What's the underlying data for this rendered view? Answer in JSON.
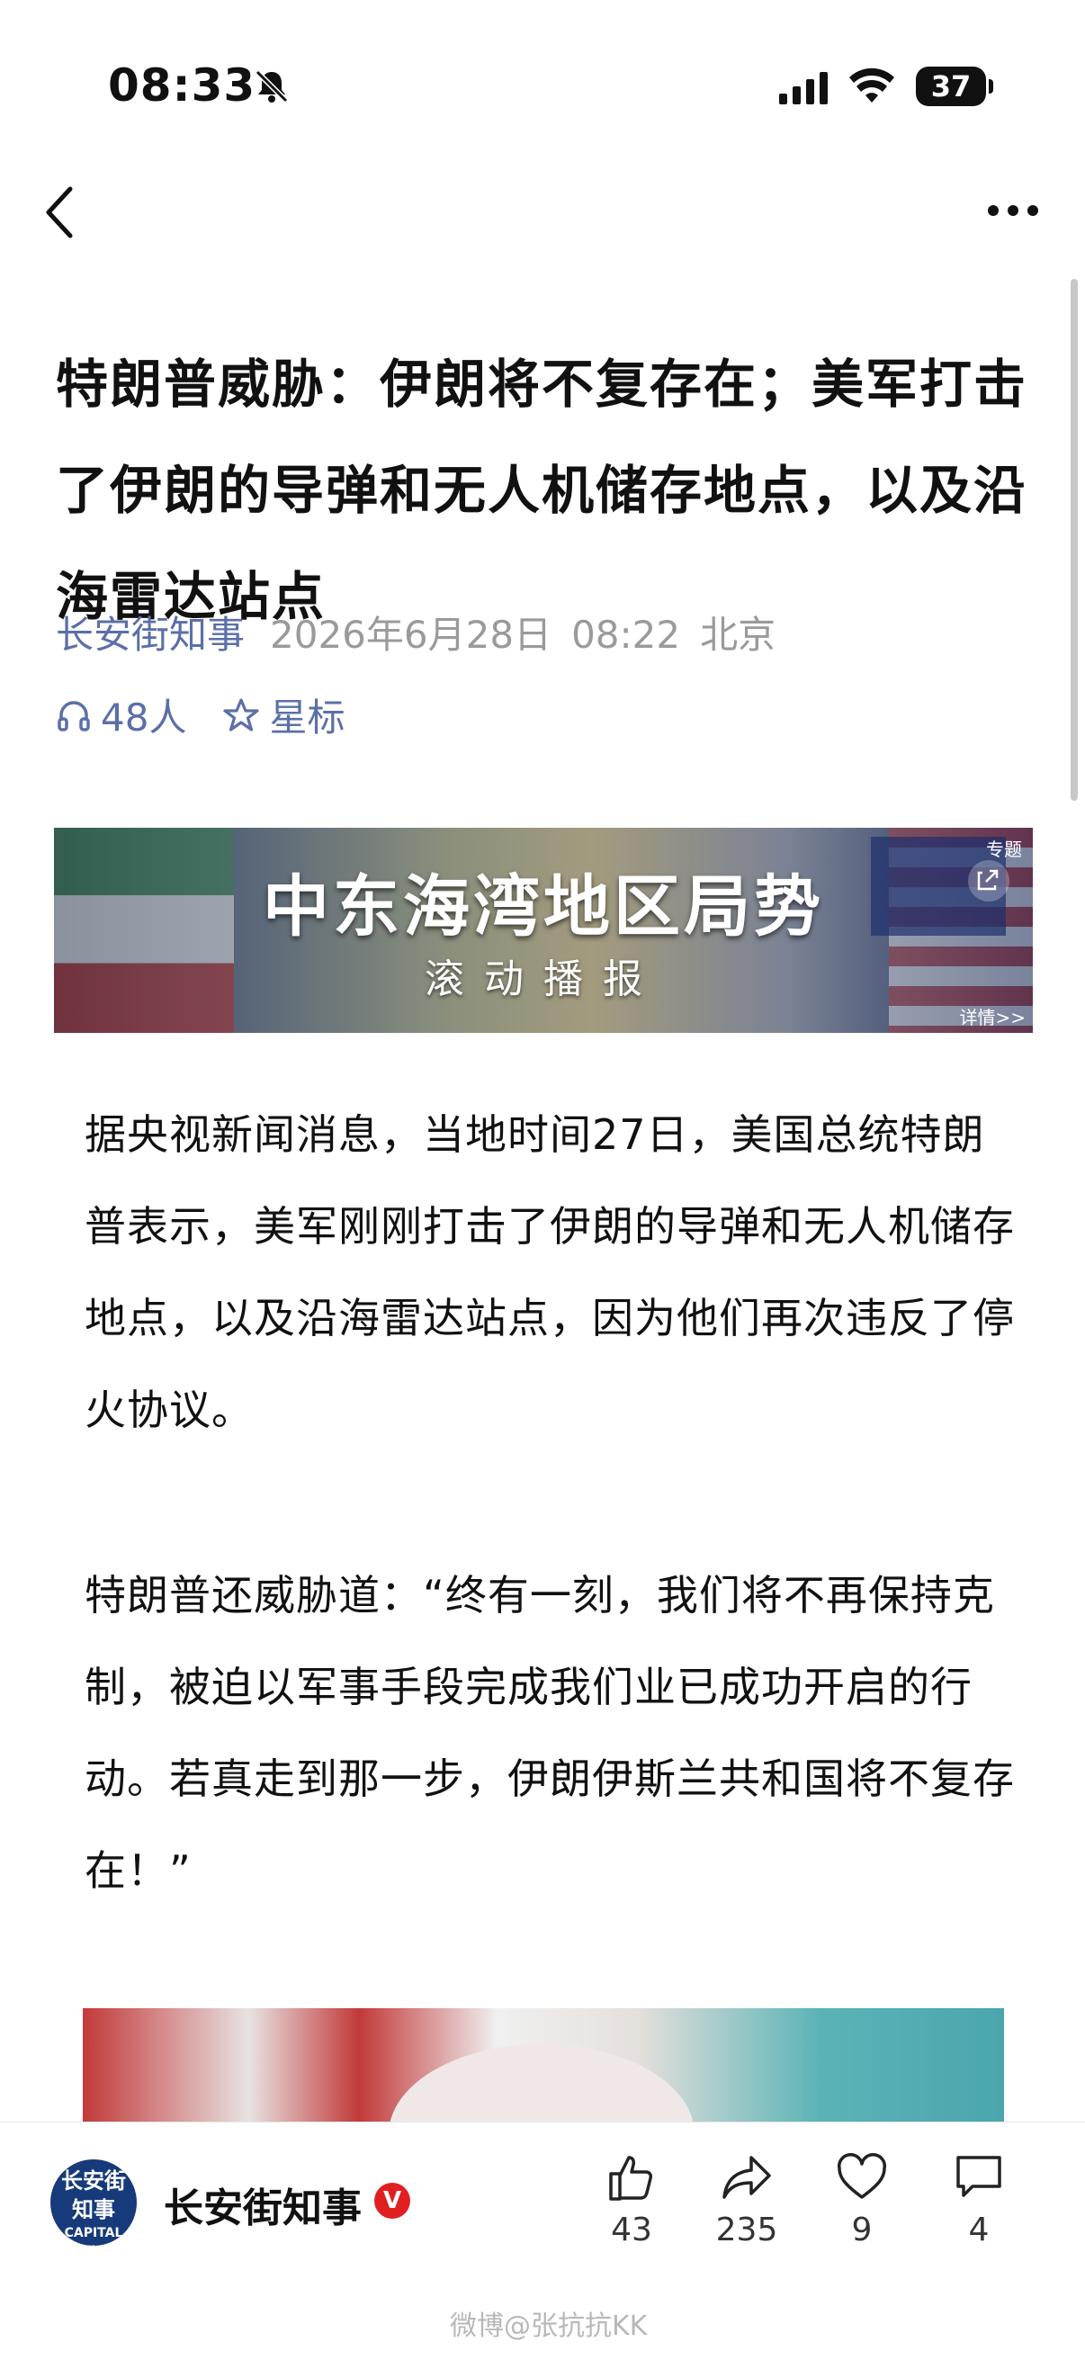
{
  "status_bar": {
    "time": "08:33",
    "battery": "37"
  },
  "article": {
    "title": "特朗普威胁：伊朗将不复存在；美军打击了伊朗的导弹和无人机储存地点，以及沿海雷达站点",
    "source": "长安街知事",
    "date": "2026年6月28日",
    "time": "08:22",
    "location": "北京",
    "listeners": "48人",
    "star_label": "星标"
  },
  "banner": {
    "title": "中东海湾地区局势",
    "subtitle": "滚动播报",
    "topic_tag": "专题",
    "detail_link": "详情>>"
  },
  "body": {
    "paragraph1": "据央视新闻消息，当地时间27日，美国总统特朗普表示，美军刚刚打击了伊朗的导弹和无人机储存地点，以及沿海雷达站点，因为他们再次违反了停火协议。",
    "paragraph2": "特朗普还威胁道：“终有一刻，我们将不再保持克制，被迫以军事手段完成我们业已成功开启的行动。若真走到那一步，伊朗伊斯兰共和国将不复存在！”"
  },
  "bottom_bar": {
    "avatar_text_top": "长安街",
    "avatar_text_mid": "知事",
    "avatar_text_en": "CAPITAL NEWS",
    "account_name": "长安街知事",
    "verified_badge": "V",
    "likes": "43",
    "shares": "235",
    "favorites": "9",
    "comments": "4"
  },
  "watermark": "微博@张抗抗KK",
  "icons": [
    "bell-muted-icon",
    "cellular-signal-icon",
    "wifi-icon",
    "back-icon",
    "more-icon",
    "headphones-icon",
    "star-icon",
    "share-icon",
    "thumbs-up-icon",
    "forward-icon",
    "heart-icon",
    "comment-icon"
  ]
}
